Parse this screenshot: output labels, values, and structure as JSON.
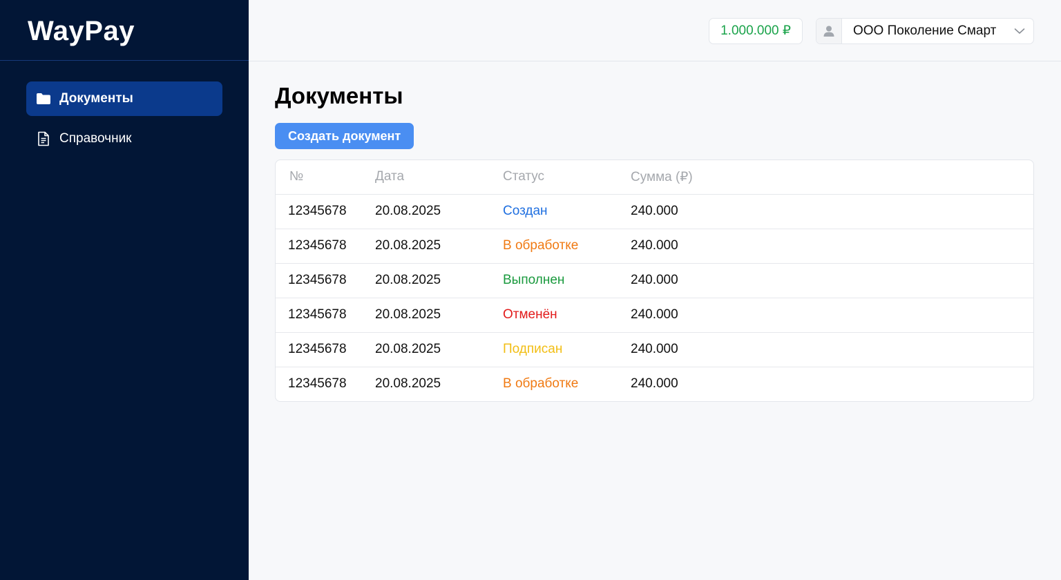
{
  "app": {
    "logo": "WayPay"
  },
  "sidebar": {
    "items": [
      {
        "label": "Документы",
        "icon": "folder-icon",
        "active": true
      },
      {
        "label": "Справочник",
        "icon": "document-icon",
        "active": false
      }
    ]
  },
  "header": {
    "balance": "1.000.000 ₽",
    "organization": "ООО Поколение Смарт",
    "user_icon": "user-icon",
    "chevron_icon": "chevron-down-icon"
  },
  "main": {
    "title": "Документы",
    "create_button": "Создать документ"
  },
  "table": {
    "columns": [
      "№",
      "Дата",
      "Статус",
      "Сумма (₽)"
    ],
    "rows": [
      {
        "number": "12345678",
        "date": "20.08.2025",
        "status": "Создан",
        "status_color": "#1f6fe0",
        "amount": "240.000"
      },
      {
        "number": "12345678",
        "date": "20.08.2025",
        "status": "В обработке",
        "status_color": "#f07a13",
        "amount": "240.000"
      },
      {
        "number": "12345678",
        "date": "20.08.2025",
        "status": "Выполнен",
        "status_color": "#1a9a3e",
        "amount": "240.000"
      },
      {
        "number": "12345678",
        "date": "20.08.2025",
        "status": "Отменён",
        "status_color": "#e21b1b",
        "amount": "240.000"
      },
      {
        "number": "12345678",
        "date": "20.08.2025",
        "status": "Подписан",
        "status_color": "#f2be14",
        "amount": "240.000"
      },
      {
        "number": "12345678",
        "date": "20.08.2025",
        "status": "В обработке",
        "status_color": "#f07a13",
        "amount": "240.000"
      }
    ]
  },
  "colors": {
    "sidebar_bg": "#021636",
    "active_nav": "#0b3a8c",
    "accent_button": "#4a8ef2",
    "balance_green": "#1aa34a"
  }
}
